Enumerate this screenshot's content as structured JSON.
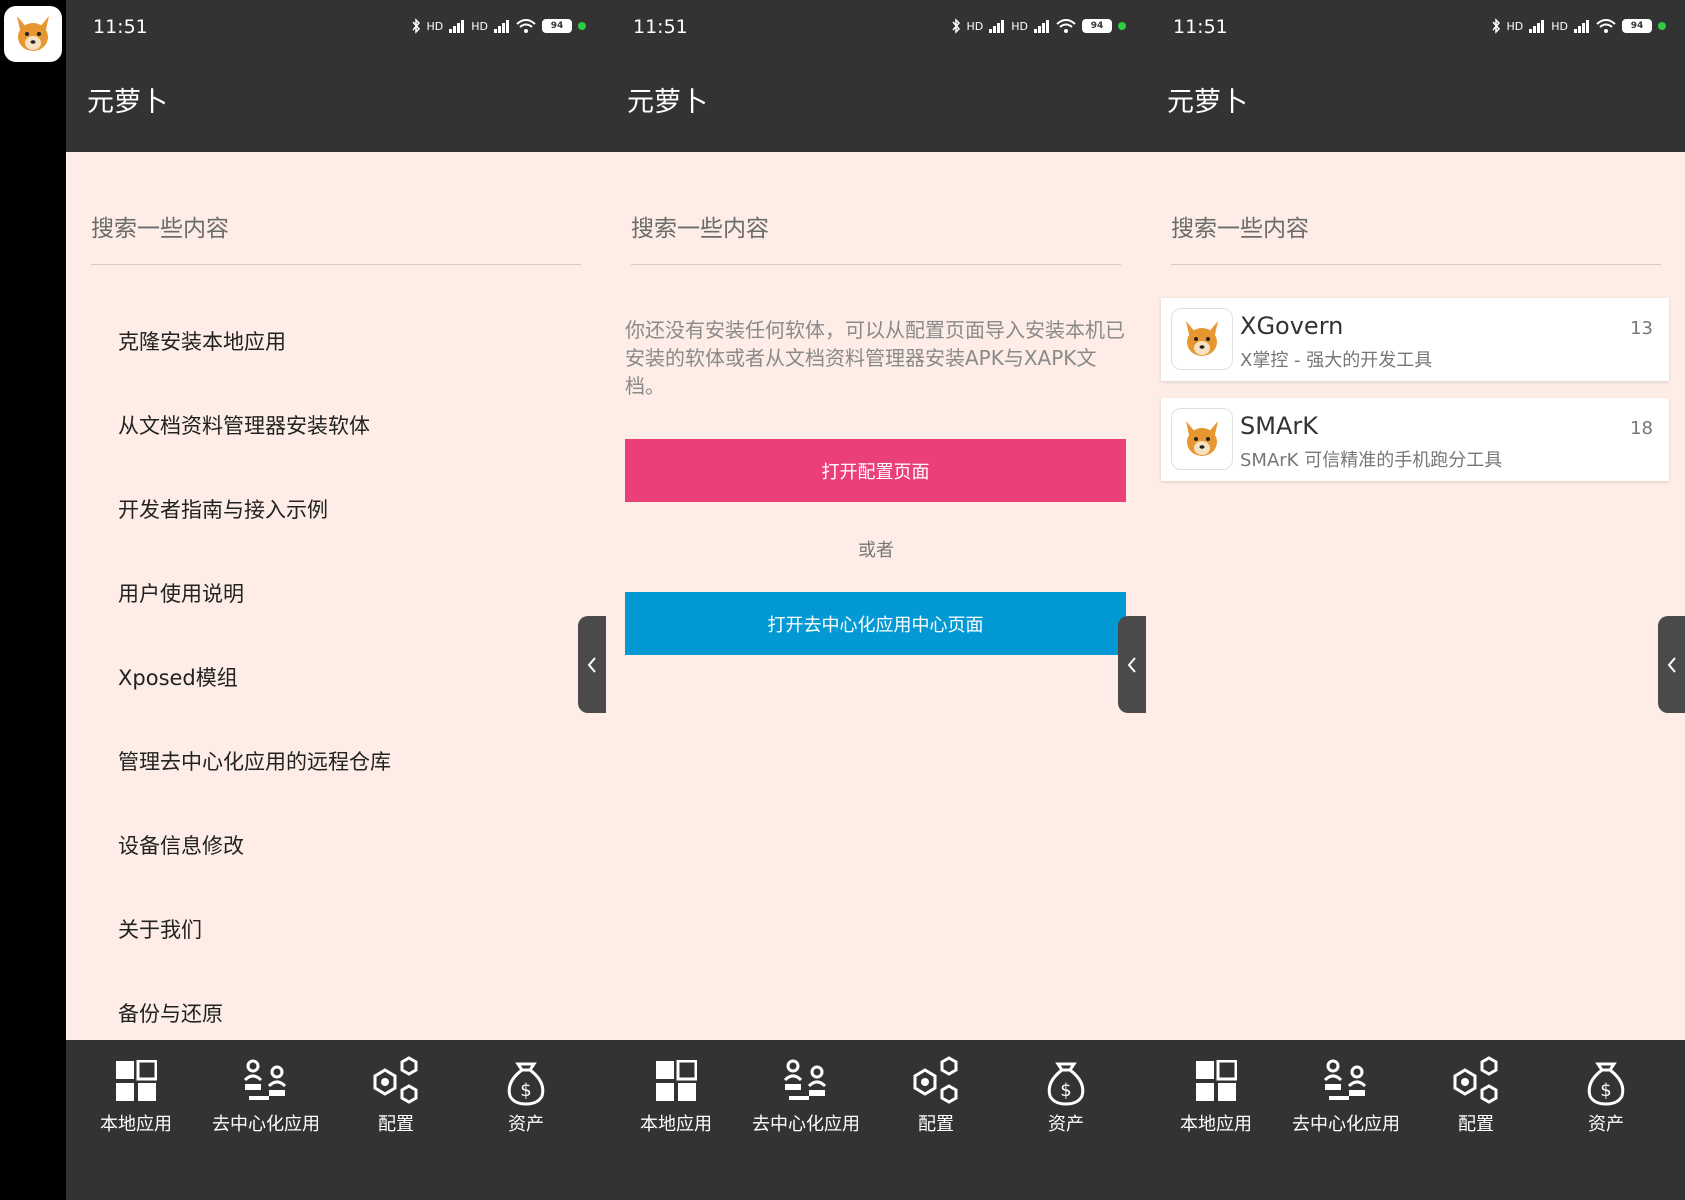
{
  "status_bar": {
    "time": "11:51",
    "battery": "94",
    "signal_label": "HD"
  },
  "app": {
    "title": "元萝卜"
  },
  "search": {
    "placeholder": "搜索一些内容"
  },
  "screen1": {
    "menu": [
      "克隆安装本地应用",
      "从文档资料管理器安装软体",
      "开发者指南与接入示例",
      "用户使用说明",
      "Xposed模组",
      "管理去中心化应用的远程仓库",
      "设备信息修改",
      "关于我们",
      "备份与还原"
    ]
  },
  "screen2": {
    "empty_message": "你还没有安装任何软体，可以从配置页面导入安装本机已安装的软体或者从文档资料管理器安装APK与XAPK文档。",
    "open_config_button": "打开配置页面",
    "or_label": "或者",
    "open_dapp_center_button": "打开去中心化应用中心页面"
  },
  "screen3": {
    "apps": [
      {
        "name": "XGovern",
        "description": "X掌控 - 强大的开发工具",
        "count": "13"
      },
      {
        "name": "SMArK",
        "description": "SMArK 可信精准的手机跑分工具",
        "count": "18"
      }
    ]
  },
  "bottom_nav": {
    "local_apps": "本地应用",
    "dapps": "去中心化应用",
    "config": "配置",
    "assets": "资产"
  },
  "colors": {
    "primary_pink": "#eb3f79",
    "primary_blue": "#0399d4",
    "bar": "#333333",
    "background": "#fdede6"
  }
}
